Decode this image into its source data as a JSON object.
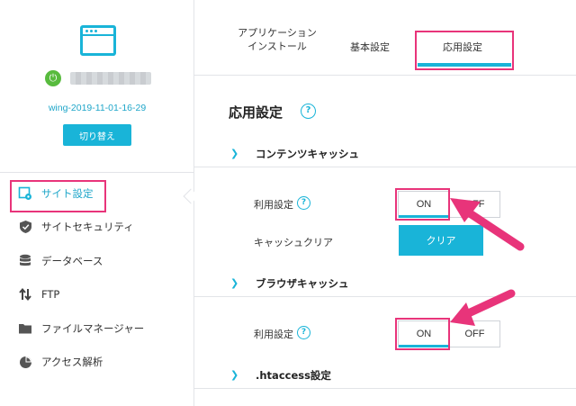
{
  "sidebar": {
    "site_name": "wing-2019-11-01-16-29",
    "switch_label": "切り替え",
    "nav": [
      {
        "label": "サイト設定",
        "icon": "site-settings-icon",
        "active": true
      },
      {
        "label": "サイトセキュリティ",
        "icon": "shield-icon"
      },
      {
        "label": "データベース",
        "icon": "database-icon"
      },
      {
        "label": "FTP",
        "icon": "transfer-arrows-icon"
      },
      {
        "label": "ファイルマネージャー",
        "icon": "folder-icon"
      },
      {
        "label": "アクセス解析",
        "icon": "pie-chart-icon"
      }
    ]
  },
  "tabs": {
    "install_line1": "アプリケーション",
    "install_line2": "インストール",
    "basic": "基本設定",
    "advanced": "応用設定"
  },
  "main": {
    "title": "応用設定",
    "content_cache": {
      "heading": "コンテンツキャッシュ",
      "usage_label": "利用設定",
      "on": "ON",
      "off": "OFF",
      "clear_label": "キャッシュクリア",
      "clear_button": "クリア"
    },
    "browser_cache": {
      "heading": "ブラウザキャッシュ",
      "usage_label": "利用設定",
      "on": "ON",
      "off": "OFF"
    },
    "htaccess": {
      "heading": ".htaccess設定"
    }
  },
  "colors": {
    "accent": "#19b4d8",
    "highlight": "#e8347a",
    "status_green": "#58bb3e"
  }
}
